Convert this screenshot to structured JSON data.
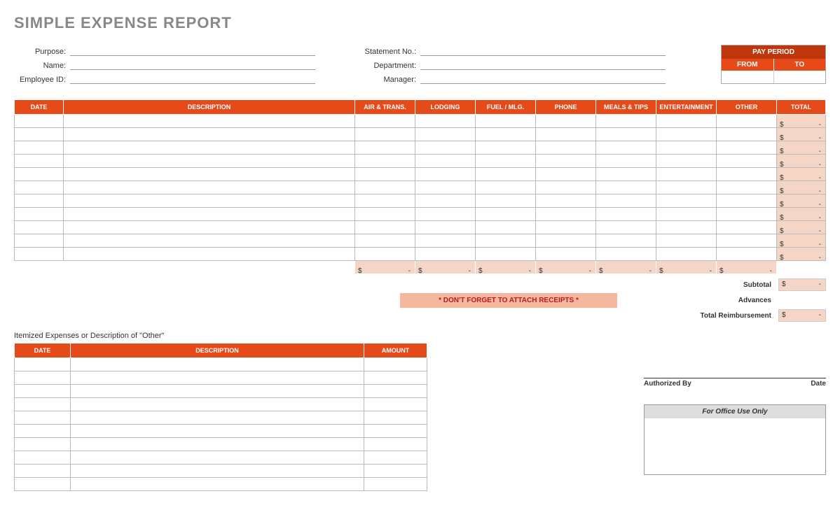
{
  "title": "SIMPLE EXPENSE REPORT",
  "header": {
    "left": [
      {
        "label": "Purpose:"
      },
      {
        "label": "Name:"
      },
      {
        "label": "Employee ID:"
      }
    ],
    "right": [
      {
        "label": "Statement No.:"
      },
      {
        "label": "Department:"
      },
      {
        "label": "Manager:"
      }
    ]
  },
  "pay_period": {
    "title": "PAY PERIOD",
    "from": "FROM",
    "to": "TO"
  },
  "expense_columns": [
    "DATE",
    "DESCRIPTION",
    "AIR & TRANS.",
    "LODGING",
    "FUEL / MLG.",
    "PHONE",
    "MEALS & TIPS",
    "ENTERTAINMENT",
    "OTHER",
    "TOTAL"
  ],
  "expense_rows": 11,
  "money": {
    "symbol": "$",
    "empty": "-"
  },
  "receipts_banner": "* DON'T FORGET TO ATTACH RECEIPTS *",
  "summary": {
    "subtotal": "Subtotal",
    "advances": "Advances",
    "total": "Total Reimbursement"
  },
  "itemized_title": "Itemized Expenses or Description of \"Other\"",
  "itemized_columns": [
    "DATE",
    "DESCRIPTION",
    "AMOUNT"
  ],
  "itemized_rows": 10,
  "signature": {
    "authorized": "Authorized By",
    "date": "Date"
  },
  "office": {
    "title": "For Office Use Only"
  }
}
